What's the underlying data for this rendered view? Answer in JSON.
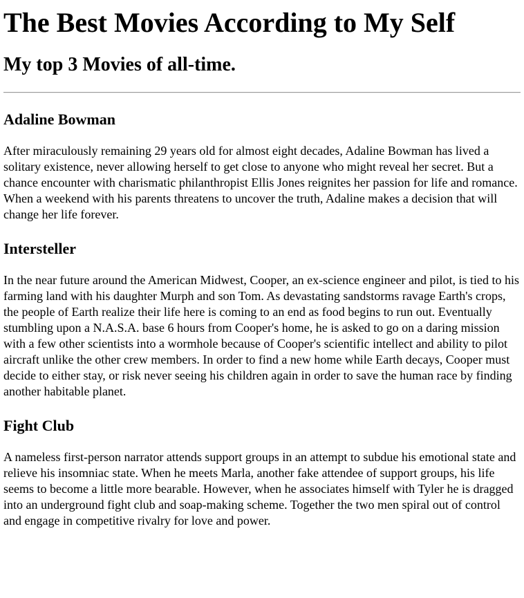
{
  "page": {
    "title": "The Best Movies According to My Self",
    "subtitle": "My top 3 Movies of all-time."
  },
  "movies": [
    {
      "title": "Adaline Bowman",
      "description": "After miraculously remaining 29 years old for almost eight decades, Adaline Bowman has lived a solitary existence, never allowing herself to get close to anyone who might reveal her secret. But a chance encounter with charismatic philanthropist Ellis Jones reignites her passion for life and romance. When a weekend with his parents threatens to uncover the truth, Adaline makes a decision that will change her life forever."
    },
    {
      "title": "Intersteller",
      "description": "In the near future around the American Midwest, Cooper, an ex-science engineer and pilot, is tied to his farming land with his daughter Murph and son Tom. As devastating sandstorms ravage Earth's crops, the people of Earth realize their life here is coming to an end as food begins to run out. Eventually stumbling upon a N.A.S.A. base 6 hours from Cooper's home, he is asked to go on a daring mission with a few other scientists into a wormhole because of Cooper's scientific intellect and ability to pilot aircraft unlike the other crew members. In order to find a new home while Earth decays, Cooper must decide to either stay, or risk never seeing his children again in order to save the human race by finding another habitable planet."
    },
    {
      "title": "Fight Club",
      "description": "A nameless first-person narrator attends support groups in an attempt to subdue his emotional state and relieve his insomniac state. When he meets Marla, another fake attendee of support groups, his life seems to become a little more bearable. However, when he associates himself with Tyler he is dragged into an underground fight club and soap-making scheme. Together the two men spiral out of control and engage in competitive rivalry for love and power."
    }
  ]
}
